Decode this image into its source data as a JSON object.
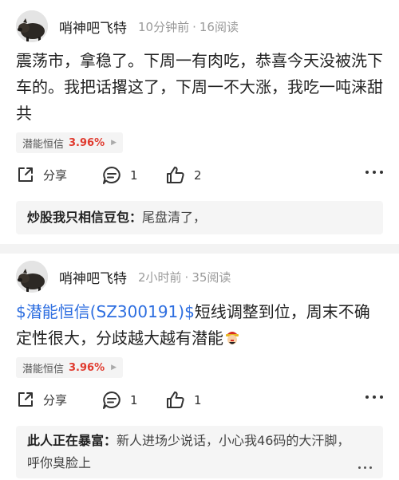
{
  "posts": [
    {
      "author": "哨神吧飞特",
      "time": "10分钟前",
      "reads": "16阅读",
      "content": "震荡市，拿稳了。下周一有肉吃，恭喜今天没被洗下车的。我把话撂这了，下周一不大涨，我吃一吨涞甜共",
      "stock": {
        "name": "潜能恒信",
        "change": "3.96%"
      },
      "actions": {
        "share": "分享",
        "comments": "1",
        "likes": "2"
      },
      "reply": {
        "name": "炒股我只相信豆包：",
        "text": "尾盘清了，"
      }
    },
    {
      "author": "哨神吧飞特",
      "time": "2小时前",
      "reads": "35阅读",
      "content_link": "$潜能恒信(SZ300191)$",
      "content": "短线调整到位，周末不确定性很大，分歧越大越有潜能",
      "stock": {
        "name": "潜能恒信",
        "change": "3.96%"
      },
      "actions": {
        "share": "分享",
        "comments": "1",
        "likes": "1"
      },
      "reply": {
        "name": "此人正在暴富：",
        "text": "新人进场少说话，小心我46码的大汗脚，呼你臭脸上"
      }
    }
  ],
  "icons": {
    "share": "share-icon",
    "comment": "comment-icon",
    "like": "thumbs-up-icon",
    "more": "more-dots-icon",
    "emoji": "money-god-emoji"
  },
  "colors": {
    "link": "#2d6ee0",
    "stock_up": "#e03a2e",
    "separator": "#f3f3f3"
  }
}
